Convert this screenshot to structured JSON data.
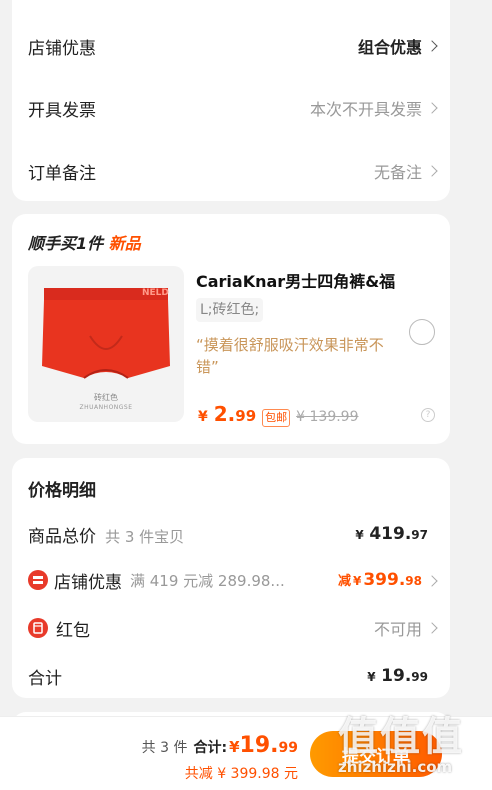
{
  "order_options": {
    "store_discount": {
      "label": "店铺优惠",
      "value": "组合优惠"
    },
    "invoice": {
      "label": "开具发票",
      "value": "本次不开具发票"
    },
    "note": {
      "label": "订单备注",
      "value": "无备注"
    }
  },
  "addon": {
    "title": "顺手买1件",
    "badge": "新品",
    "product": {
      "name": "CariaKnar男士四角裤&福",
      "variant": "L;砖红色;",
      "review": "“摸着很舒服吸汗效果非常不错”",
      "image_color_label": "砖红色",
      "image_color_pinyin": "ZHUANHONGSE",
      "image_brand": "NELD",
      "price_symbol": "¥",
      "price_int": "2.",
      "price_dec": "99",
      "shipping_tag": "包邮",
      "original_price": "¥ 139.99"
    }
  },
  "price_detail": {
    "title": "价格明细",
    "items_total": {
      "label": "商品总价",
      "sub": "共 3 件宝贝",
      "symbol": "¥",
      "int": "419.",
      "dec": "97"
    },
    "store_discount": {
      "label": "店铺优惠",
      "sub": "满 419 元减 289.98...",
      "prefix": "减",
      "symbol": "¥",
      "int": "399.",
      "dec": "98"
    },
    "red_packet": {
      "label": "红包",
      "value": "不可用"
    },
    "total": {
      "label": "合计",
      "symbol": "¥",
      "int": "19.",
      "dec": "99"
    }
  },
  "bottom_bar": {
    "count": "共 3 件",
    "total_label": "合计:",
    "symbol": "¥",
    "int": "19.",
    "dec": "99",
    "saved": "共减 ¥ 399.98 元",
    "submit": "提交订单"
  },
  "watermark": {
    "text": "值值值",
    "url": "zhizhizhi.com"
  },
  "colors": {
    "accent": "#ff5000",
    "button": "#ff7a00"
  }
}
